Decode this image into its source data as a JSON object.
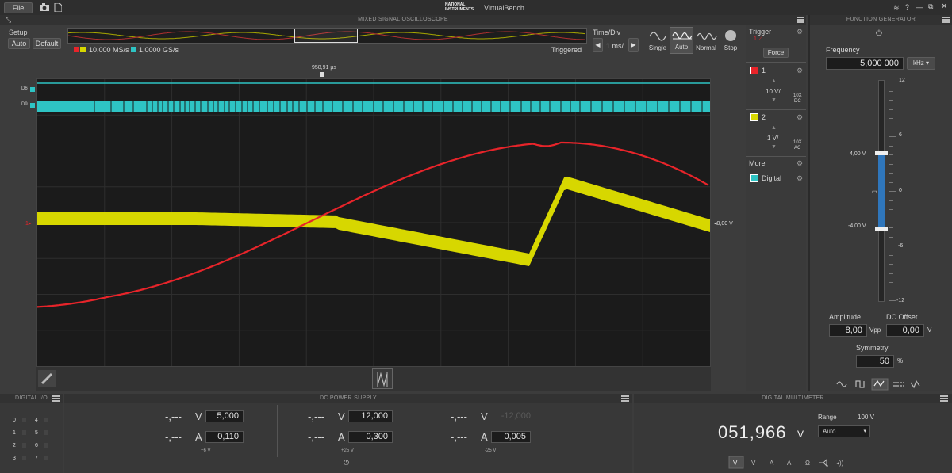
{
  "titlebar": {
    "file": "File",
    "app": "VirtualBench",
    "brand": "NATIONAL INSTRUMENTS",
    "help": "?"
  },
  "scope": {
    "title": "MIXED SIGNAL OSCILLOSCOPE",
    "setup_label": "Setup",
    "auto_btn": "Auto",
    "default_btn": "Default",
    "analog_rate": "10,000 MS/s",
    "digital_rate": "1,0000 GS/s",
    "triggered": "Triggered",
    "timediv_label": "Time/Div",
    "timediv_value": "1 ms/",
    "modes": [
      "Single",
      "Auto",
      "Normal",
      "Stop"
    ],
    "trigger_time": "958,91 µs",
    "trigger_level": "0,00 V",
    "digital_channels": [
      "D6",
      "D9"
    ],
    "channel_marker": "1"
  },
  "side": {
    "trigger_label": "Trigger",
    "trigger_src": "1",
    "force_btn": "Force",
    "ch1": {
      "num": "1",
      "scale": "10 V/",
      "probe": "10X",
      "coupling": "DC",
      "color": "#d42828"
    },
    "ch2": {
      "num": "2",
      "scale": "1 V/",
      "probe": "10X",
      "coupling": "AC",
      "color": "#d8d800"
    },
    "more": "More",
    "digital": "Digital"
  },
  "fgen": {
    "title": "FUNCTION GENERATOR",
    "freq_label": "Frequency",
    "freq_value": "5,000 000",
    "freq_unit": "kHz",
    "scale": [
      "12",
      "6",
      "4,00 V",
      "0",
      "-4,00 V",
      "-6",
      "-12"
    ],
    "amp_label": "Amplitude",
    "amp_value": "8,00",
    "amp_unit": "Vpp",
    "offset_label": "DC Offset",
    "offset_value": "0,00",
    "offset_unit": "V",
    "sym_label": "Symmetry",
    "sym_value": "50",
    "sym_unit": "%"
  },
  "dio": {
    "title": "DIGITAL I/O",
    "col1": [
      "0",
      "1",
      "2",
      "3"
    ],
    "col2": [
      "4",
      "5",
      "6",
      "7"
    ]
  },
  "psu": {
    "title": "DC POWER SUPPLY",
    "channels": [
      {
        "meas_v": "-,---",
        "v_unit": "V",
        "set_v": "5,000",
        "meas_a": "-,---",
        "a_unit": "A",
        "set_a": "0,110",
        "label": "+6 V"
      },
      {
        "meas_v": "-,---",
        "v_unit": "V",
        "set_v": "12,000",
        "meas_a": "-,---",
        "a_unit": "A",
        "set_a": "0,300",
        "label": "+25 V"
      },
      {
        "meas_v": "-,---",
        "v_unit": "V",
        "set_v": "-12,000",
        "meas_a": "-,---",
        "a_unit": "A",
        "set_a": "0,005",
        "label": "-25 V"
      }
    ]
  },
  "dmm": {
    "title": "DIGITAL MULTIMETER",
    "reading": "051,966",
    "unit": "V",
    "range_label": "Range",
    "range_value": "100 V",
    "mode": "Auto"
  },
  "colors": {
    "ch1": "#e8242a",
    "ch2": "#d7d700",
    "digital": "#2ec4c4",
    "bg": "#1b1b1b"
  }
}
